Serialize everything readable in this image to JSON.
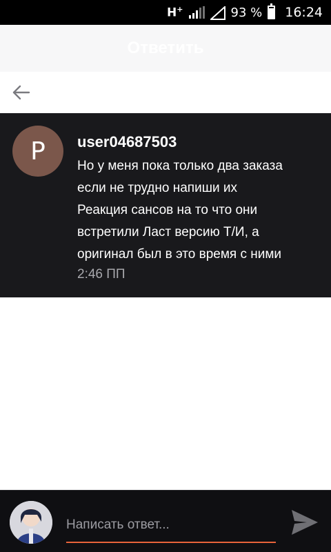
{
  "status_bar": {
    "network": "H",
    "network_sup": "+",
    "battery_percent": "93 %",
    "time": "16:24"
  },
  "header": {
    "title": "Ответить"
  },
  "message": {
    "avatar_letter": "P",
    "username": "user04687503",
    "lines": [
      "Но у меня пока только два заказа",
      "если не трудно напиши их",
      "Реакция сансов на то что они",
      "встретили  Ласт версию Т/И, а",
      "оригинал был в это время с ними"
    ],
    "time": "2:46 ПП"
  },
  "composer": {
    "placeholder": "Написать ответ..."
  },
  "colors": {
    "accent": "#e8633a",
    "message_bg": "#19191c",
    "avatar_bg": "#7b574b"
  },
  "icons": [
    "back-arrow-icon",
    "send-icon",
    "signal-icon",
    "battery-icon",
    "wifi-triangle-icon"
  ]
}
